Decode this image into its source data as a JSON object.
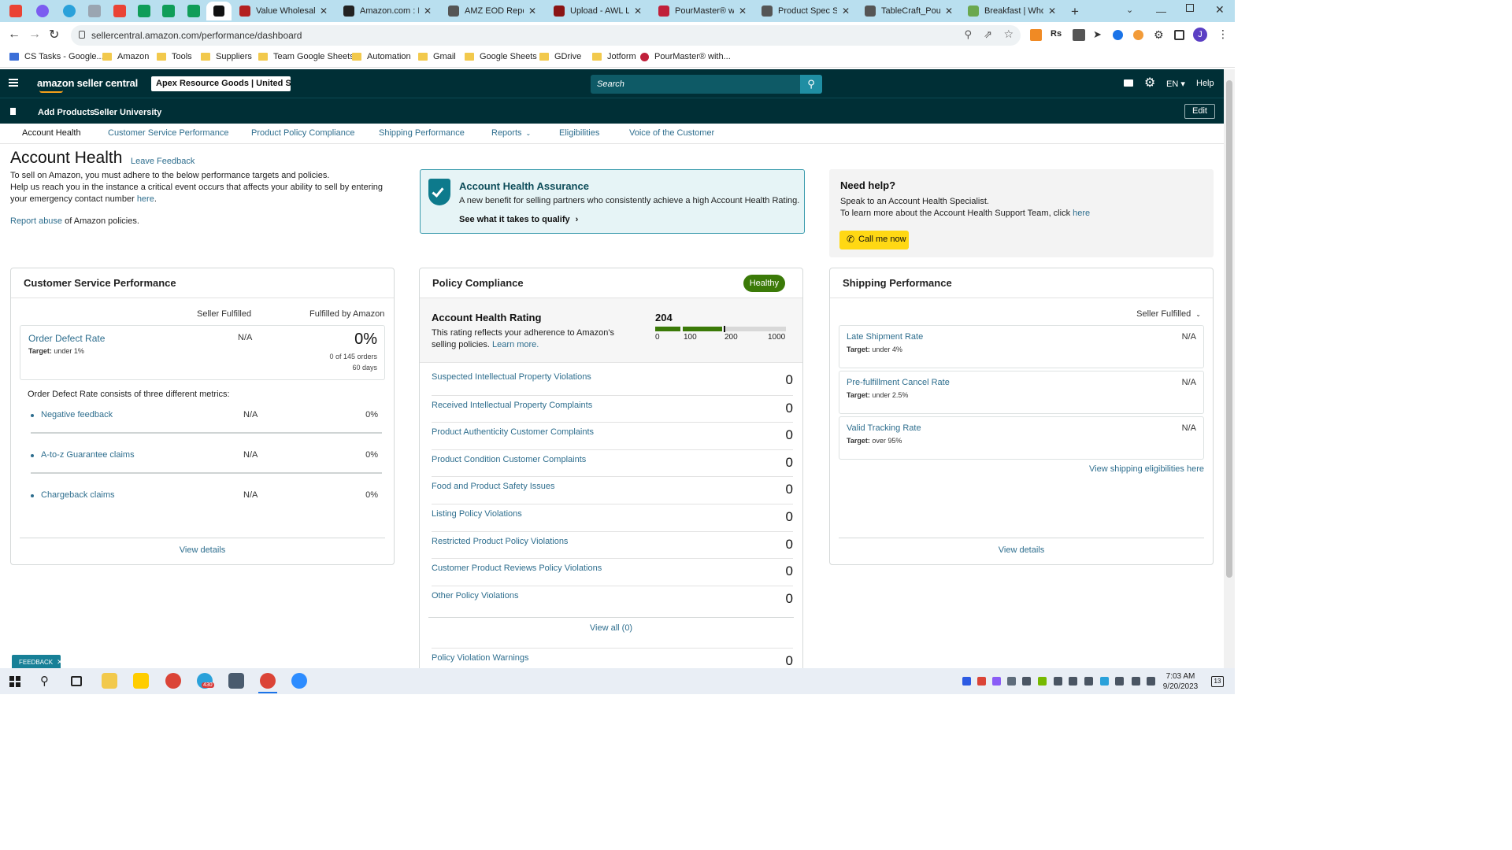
{
  "browser": {
    "tabs": [
      {
        "title": "Value Wholesale",
        "color": "#b32020"
      },
      {
        "title": "Amazon.com : Hu",
        "color": "#222222"
      },
      {
        "title": "AMZ EOD Report",
        "color": "#555555"
      },
      {
        "title": "Upload - AWL LAB",
        "color": "#8a1414"
      },
      {
        "title": "PourMaster® with",
        "color": "#c0203a"
      },
      {
        "title": "Product Spec Shee",
        "color": "#555555"
      },
      {
        "title": "TableCraft_Pourma",
        "color": "#555555"
      },
      {
        "title": "Breakfast | Wholes",
        "color": "#6aa84f"
      }
    ],
    "url": "sellercentral.amazon.com/performance/dashboard",
    "bookmarks": [
      "CS Tasks - Google...",
      "Amazon",
      "Tools",
      "Suppliers",
      "Team Google Sheets",
      "Automation",
      "Gmail",
      "Google Sheets",
      "GDrive",
      "Jotform",
      "PourMaster® with..."
    ],
    "profile_initial": "J"
  },
  "header": {
    "logo": "amazon seller central",
    "account": "Apex Resource Goods | United St...",
    "search_placeholder": "Search",
    "lang": "EN",
    "help": "Help",
    "sub_links": [
      "Add Products",
      "Seller University"
    ],
    "edit": "Edit"
  },
  "nav": {
    "items": [
      "Account Health",
      "Customer Service Performance",
      "Product Policy Compliance",
      "Shipping Performance",
      "Reports",
      "Eligibilities",
      "Voice of the Customer"
    ]
  },
  "page": {
    "title": "Account Health",
    "feedback_link": "Leave Feedback",
    "intro1": "To sell on Amazon, you must adhere to the below performance targets and policies.",
    "intro2": "Help us reach you in the instance a critical event occurs that affects your ability to sell by entering your emergency contact number",
    "intro2_link": "here",
    "report_link": "Report abuse",
    "report_text": "of Amazon policies."
  },
  "assurance": {
    "title": "Account Health Assurance",
    "desc": "A new benefit for selling partners who consistently achieve a high Account Health Rating.",
    "link": "See what it takes to qualify",
    "color": "#007185"
  },
  "help_box": {
    "title": "Need help?",
    "line1": "Speak to an Account Health Specialist.",
    "line2": "To learn more about the Account Health Support Team, click",
    "line2_link": "here",
    "button": "Call me now"
  },
  "csp": {
    "title": "Customer Service Performance",
    "col1": "Seller Fulfilled",
    "col2": "Fulfilled by Amazon",
    "odr_label": "Order Defect Rate",
    "odr_target_label": "Target:",
    "odr_target": "under 1%",
    "odr_sf": "N/A",
    "odr_fba": "0%",
    "odr_orders": "0 of 145 orders",
    "odr_days": "60 days",
    "consists": "Order Defect Rate consists of three different metrics:",
    "metrics": [
      {
        "label": "Negative feedback",
        "sf": "N/A",
        "fba": "0%"
      },
      {
        "label": "A-to-z Guarantee claims",
        "sf": "N/A",
        "fba": "0%"
      },
      {
        "label": "Chargeback claims",
        "sf": "N/A",
        "fba": "0%"
      }
    ],
    "view": "View details"
  },
  "policy": {
    "title": "Policy Compliance",
    "status": "Healthy",
    "status_color": "#3b7a08",
    "ahr_title": "Account Health Rating",
    "ahr_desc": "This rating reflects your adherence to Amazon's selling policies.",
    "ahr_link": "Learn more.",
    "rating": "204",
    "rating_value": 204,
    "scale": [
      "0",
      "100",
      "200",
      "1000"
    ],
    "violations": [
      {
        "label": "Suspected Intellectual Property Violations",
        "count": "0"
      },
      {
        "label": "Received Intellectual Property Complaints",
        "count": "0"
      },
      {
        "label": "Product Authenticity Customer Complaints",
        "count": "0"
      },
      {
        "label": "Product Condition Customer Complaints",
        "count": "0"
      },
      {
        "label": "Food and Product Safety Issues",
        "count": "0"
      },
      {
        "label": "Listing Policy Violations",
        "count": "0"
      },
      {
        "label": "Restricted Product Policy Violations",
        "count": "0"
      },
      {
        "label": "Customer Product Reviews Policy Violations",
        "count": "0"
      },
      {
        "label": "Other Policy Violations",
        "count": "0"
      }
    ],
    "view_all": "View all (0)",
    "warnings_label": "Policy Violation Warnings",
    "warnings_count": "0"
  },
  "shipping": {
    "title": "Shipping Performance",
    "filter": "Seller Fulfilled",
    "metrics": [
      {
        "label": "Late Shipment Rate",
        "target_label": "Target:",
        "target": "under 4%",
        "value": "N/A"
      },
      {
        "label": "Pre-fulfillment Cancel Rate",
        "target_label": "Target:",
        "target": "under 2.5%",
        "value": "N/A"
      },
      {
        "label": "Valid Tracking Rate",
        "target_label": "Target:",
        "target": "over 95%",
        "value": "N/A"
      }
    ],
    "eligibility": "View shipping eligibilities here",
    "view": "View details"
  },
  "feedback_tab": "FEEDBACK",
  "taskbar": {
    "time": "7:03 AM",
    "date": "9/20/2023",
    "telegram_badge": "430",
    "notif_count": "13"
  }
}
